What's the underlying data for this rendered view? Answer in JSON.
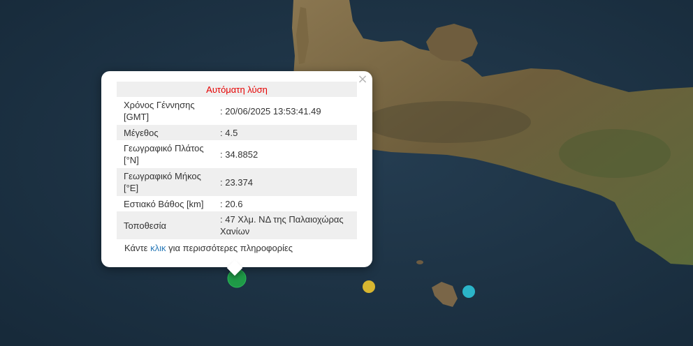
{
  "popup": {
    "title": "Αυτόματη λύση",
    "close_symbol": "×",
    "rows": [
      {
        "label": "Χρόνος Γέννησης [GMT]",
        "value": ": 20/06/2025 13:53:41.49"
      },
      {
        "label": "Μέγεθος",
        "value": ": 4.5"
      },
      {
        "label": "Γεωγραφικό Πλάτος [°N]",
        "value": ": 34.8852"
      },
      {
        "label": "Γεωγραφικό Μήκος [°E]",
        "value": ": 23.374"
      },
      {
        "label": "Εστιακό Βάθος [km]",
        "value": ": 20.6"
      },
      {
        "label": "Τοποθεσία",
        "value": ": 47 Χλμ. ΝΔ της Παλαιοχώρας Χανίων"
      }
    ],
    "footer_prefix": "Κάντε ",
    "footer_link": "κλικ",
    "footer_suffix": " για περισσότερες πληροφορίες"
  },
  "colors": {
    "sea": "#1d3345",
    "land": "#7a6a48",
    "title_red": "#e60000",
    "link_blue": "#2a7ab8",
    "marker_green": "#1f9a47",
    "marker_yellow": "#d8b630",
    "marker_cyan": "#2bb5c9"
  },
  "markers": [
    {
      "name": "earthquake-marker-selected",
      "color": "#1f9a47"
    },
    {
      "name": "earthquake-marker-yellow",
      "color": "#d8b630"
    },
    {
      "name": "earthquake-marker-cyan",
      "color": "#2bb5c9"
    }
  ]
}
